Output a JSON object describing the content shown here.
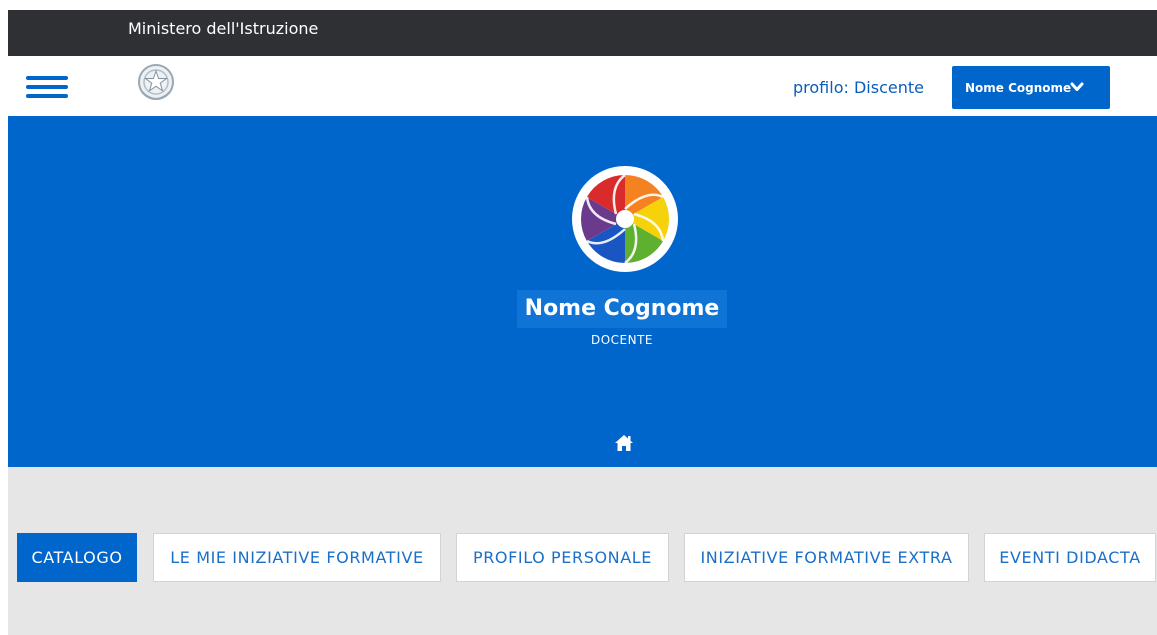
{
  "topbar": {
    "ministry": "Ministero dell'Istruzione"
  },
  "header": {
    "profile_label": "profilo: Discente",
    "user_button": "Nome Cognome",
    "icons": [
      "hamburger-menu-icon",
      "republic-emblem-icon",
      "chevron-down-icon"
    ]
  },
  "hero": {
    "name": "Nome Cognome",
    "role": "DOCENTE",
    "icons": [
      "rainbow-swirl-logo",
      "home-icon"
    ]
  },
  "tabs": [
    {
      "label": "CATALOGO",
      "active": true
    },
    {
      "label": "LE MIE INIZIATIVE FORMATIVE",
      "active": false
    },
    {
      "label": "PROFILO PERSONALE",
      "active": false
    },
    {
      "label": "INIZIATIVE FORMATIVE EXTRA",
      "active": false
    },
    {
      "label": "EVENTI DIDACTA",
      "active": false
    }
  ],
  "colors": {
    "brand_blue": "#0066cc",
    "topbar": "#2f3033",
    "content_bg": "#e6e6e6"
  }
}
